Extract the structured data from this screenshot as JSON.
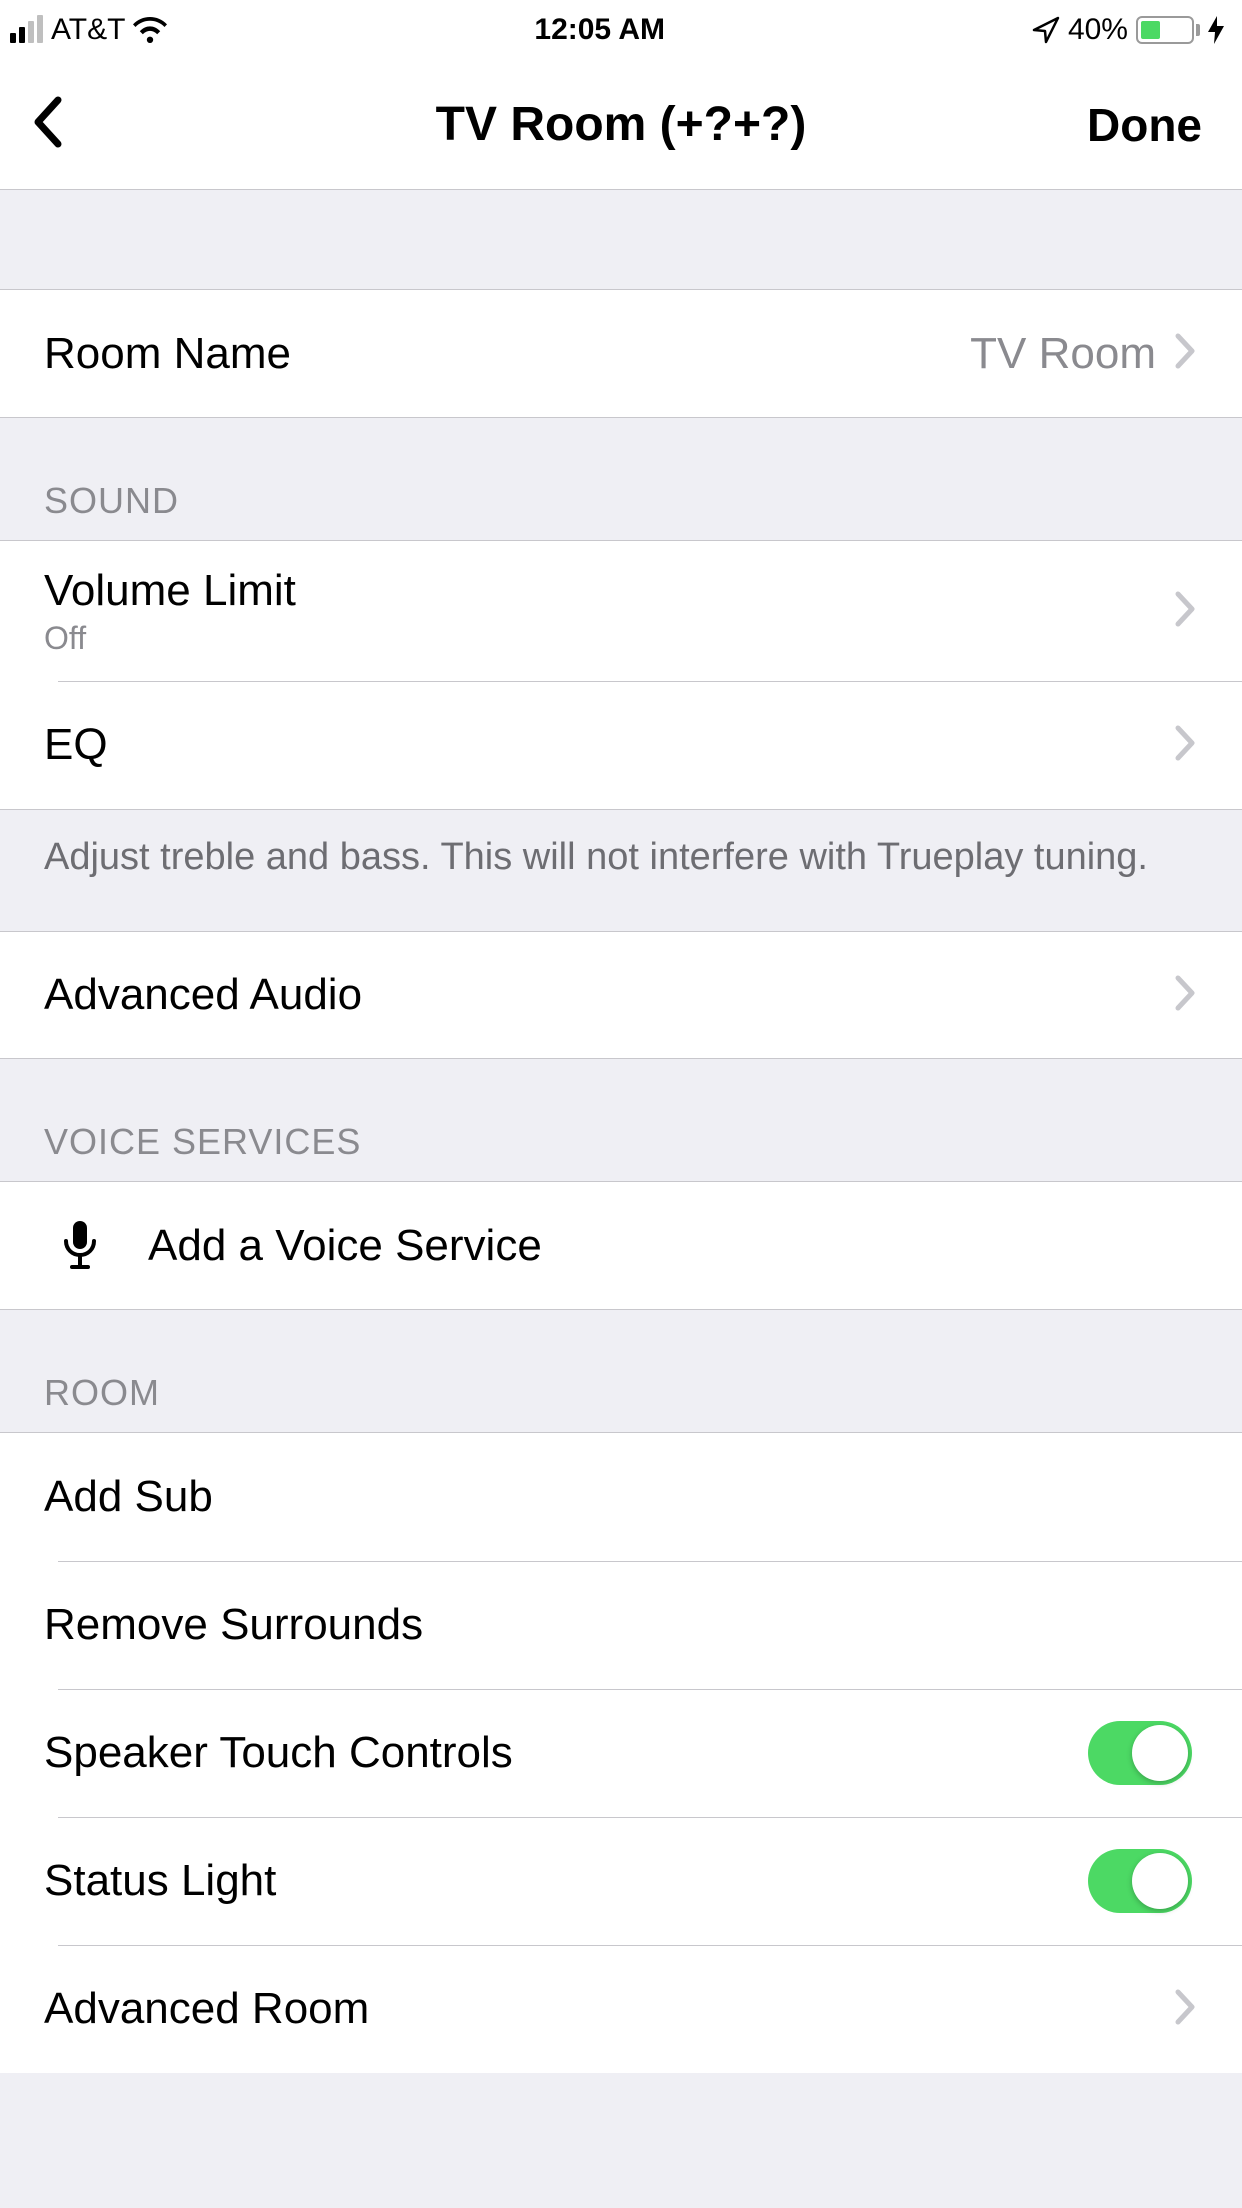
{
  "statusBar": {
    "carrier": "AT&T",
    "time": "12:05 AM",
    "batteryText": "40%",
    "batteryLevel": 40
  },
  "nav": {
    "title": "TV Room (+?+?)",
    "done": "Done"
  },
  "roomName": {
    "label": "Room Name",
    "value": "TV Room"
  },
  "sound": {
    "header": "Sound",
    "volumeLimit": {
      "label": "Volume Limit",
      "value": "Off"
    },
    "eq": {
      "label": "EQ"
    },
    "footer": "Adjust treble and bass. This will not interfere with Trueplay tuning."
  },
  "advancedAudio": {
    "label": "Advanced Audio"
  },
  "voiceServices": {
    "header": "Voice Services",
    "add": "Add a Voice Service"
  },
  "room": {
    "header": "Room",
    "addSub": "Add Sub",
    "removeSurrounds": "Remove Surrounds",
    "speakerTouch": {
      "label": "Speaker Touch Controls",
      "on": true
    },
    "statusLight": {
      "label": "Status Light",
      "on": true
    },
    "advancedRoom": "Advanced Room"
  }
}
